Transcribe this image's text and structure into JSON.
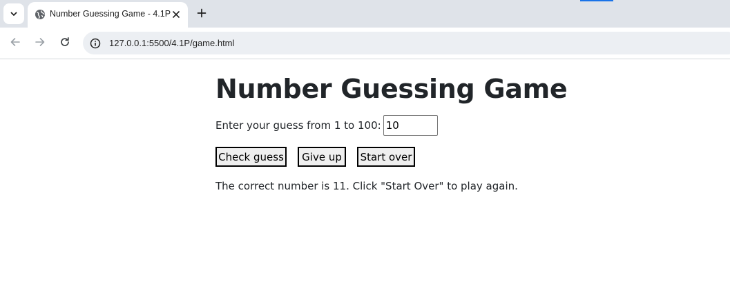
{
  "browser": {
    "tab": {
      "title": "Number Guessing Game - 4.1P",
      "favicon": "globe-icon"
    },
    "url": "127.0.0.1:5500/4.1P/game.html",
    "colors": {
      "tabstrip_bg": "#dfe3e9",
      "omnibox_bg": "#eceff3",
      "accent": "#1a73e8"
    }
  },
  "game": {
    "title": "Number Guessing Game",
    "prompt_label": "Enter your guess from 1 to 100:",
    "guess_value": "10",
    "buttons": {
      "check": "Check guess",
      "give_up": "Give up",
      "start_over": "Start over"
    },
    "result_message": "The correct number is 11. Click \"Start Over\" to play again."
  }
}
